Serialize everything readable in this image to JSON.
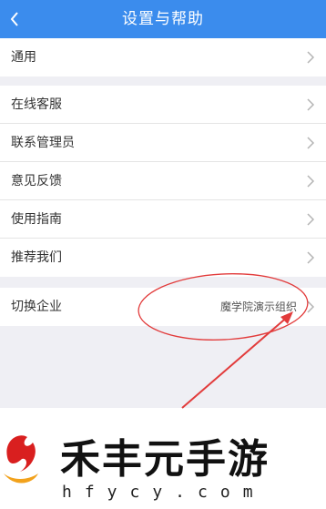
{
  "header": {
    "title": "设置与帮助",
    "back_icon": "chevron-left-icon"
  },
  "groups": [
    {
      "items": [
        {
          "label": "通用"
        }
      ]
    },
    {
      "items": [
        {
          "label": "在线客服"
        },
        {
          "label": "联系管理员"
        },
        {
          "label": "意见反馈"
        },
        {
          "label": "使用指南"
        },
        {
          "label": "推荐我们"
        }
      ]
    },
    {
      "items": [
        {
          "label": "切换企业",
          "value": "魔学院演示组织"
        }
      ]
    }
  ],
  "watermark": {
    "text": "禾丰元手游",
    "sub": "hfycy.com"
  },
  "colors": {
    "header": "#3b8ced",
    "annotation": "#e23b3b"
  }
}
